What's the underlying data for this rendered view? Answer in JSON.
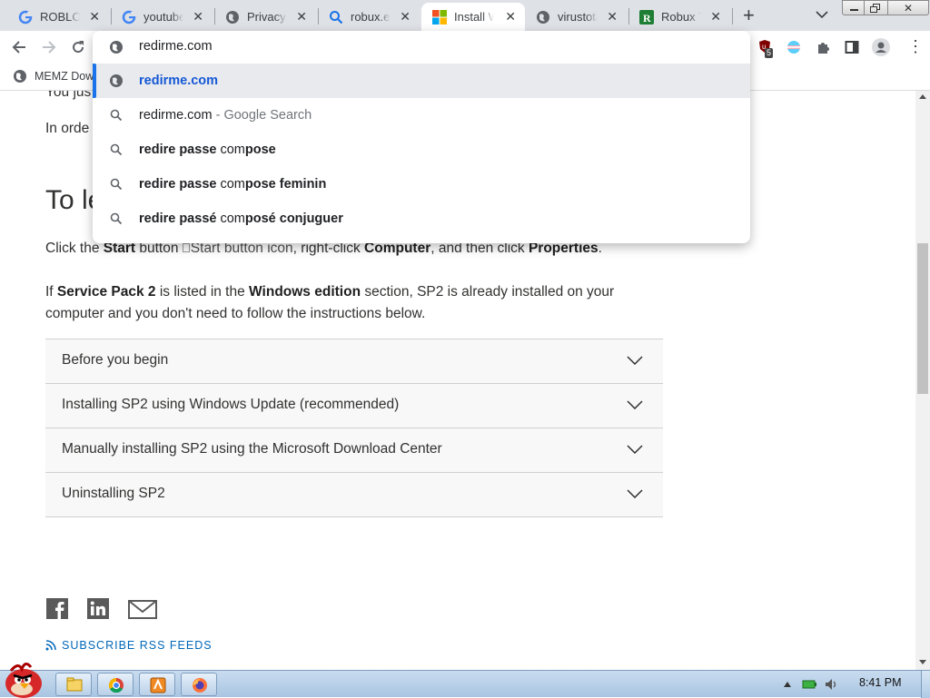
{
  "browser": {
    "tabs": [
      {
        "title": "ROBLOX",
        "icon": "google-g-icon"
      },
      {
        "title": "youtube",
        "icon": "google-g-icon"
      },
      {
        "title": "Privacy e",
        "icon": "globe-icon"
      },
      {
        "title": "robux.ex",
        "icon": "search-icon"
      },
      {
        "title": "Install W",
        "icon": "windows-logo-icon",
        "active": true
      },
      {
        "title": "virustota",
        "icon": "globe-icon"
      },
      {
        "title": "Robux To",
        "icon": "r-logo-icon"
      }
    ],
    "new_tab_label": "+",
    "extension_badge": "5",
    "address_value": "redirme.com",
    "bookmark": "MEMZ Dow"
  },
  "omnibox": {
    "suggestions": [
      {
        "bold": "redirme.com",
        "rest": "",
        "suffix": "",
        "icon": "globe-icon"
      },
      {
        "bold": "",
        "rest": "redirme.com",
        "suffix": " - Google Search",
        "icon": "search-icon"
      },
      {
        "bold": "redire passe ",
        "rest": "com",
        "suffix": "pose",
        "icon": "search-icon"
      },
      {
        "bold": "redire passe ",
        "rest": "com",
        "suffix": "pose feminin",
        "icon": "search-icon"
      },
      {
        "bold": "redire passé ",
        "rest": "com",
        "suffix": "posé conjuguer",
        "icon": "search-icon"
      }
    ]
  },
  "page": {
    "partial_line_1": "You jus",
    "partial_line_2": "In orde",
    "heading_partial": "To le",
    "p1": {
      "a": "Click the ",
      "b": "Start",
      "c": " button ",
      "img_alt": "Start button icon",
      "d": ", right-click ",
      "e": "Computer",
      "f": ", and then click ",
      "g": "Properties",
      "h": "."
    },
    "p2": {
      "a": "If ",
      "b": "Service Pack 2",
      "c": " is listed in the ",
      "d": "Windows edition",
      "e": " section, SP2 is already installed on your",
      "line2": "computer and you don't need to follow the instructions below."
    },
    "accordion": [
      "Before you begin",
      "Installing SP2 using Windows Update (recommended)",
      "Manually installing SP2 using the Microsoft Download Center",
      "Uninstalling SP2"
    ],
    "social": [
      "facebook-icon",
      "linkedin-icon",
      "mail-icon"
    ],
    "rss_label": "SUBSCRIBE RSS FEEDS"
  },
  "taskbar": {
    "clock": "8:41 PM"
  }
}
